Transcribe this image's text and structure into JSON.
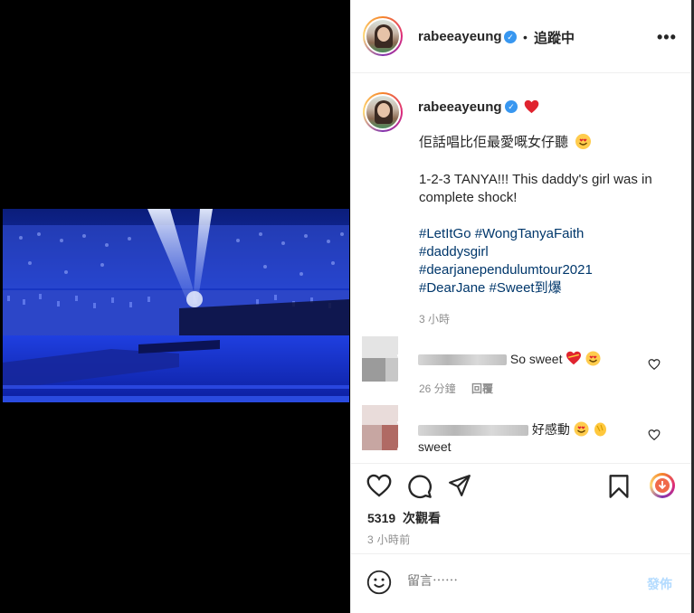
{
  "post": {
    "username": "rabeeayeung",
    "separator": "•",
    "follow_status": "追蹤中",
    "more_icon": "more-horizontal-icon"
  },
  "caption": {
    "username": "rabeeayeung",
    "line1": "佢話唱比佢最愛嘅女仔聽",
    "line2": "1-2-3 TANYA!!! This daddy's girl was in",
    "line3": "complete shock!",
    "tags_line1": "#LetItGo #WongTanyaFaith",
    "tags_line2": "#daddysgirl",
    "tags_line3": "#dearjanependulumtour2021",
    "tags_line4": "#DearJane #Sweet到爆",
    "time": "3 小時"
  },
  "comments": [
    {
      "text": "So sweet",
      "time": "26 分鐘",
      "reply": "回覆"
    },
    {
      "text_visible": "好感動",
      "text_line2": "sweet"
    }
  ],
  "footer": {
    "views_count": "5319",
    "views_label": "次觀看",
    "time_ago": "3 小時前",
    "comment_placeholder": "留言⋯⋯",
    "post_label": "發佈"
  },
  "colors": {
    "verified": "#3897f0",
    "hashtag": "#00376b",
    "muted": "#8e8e8e",
    "post_button_disabled": "#b3dbff"
  }
}
